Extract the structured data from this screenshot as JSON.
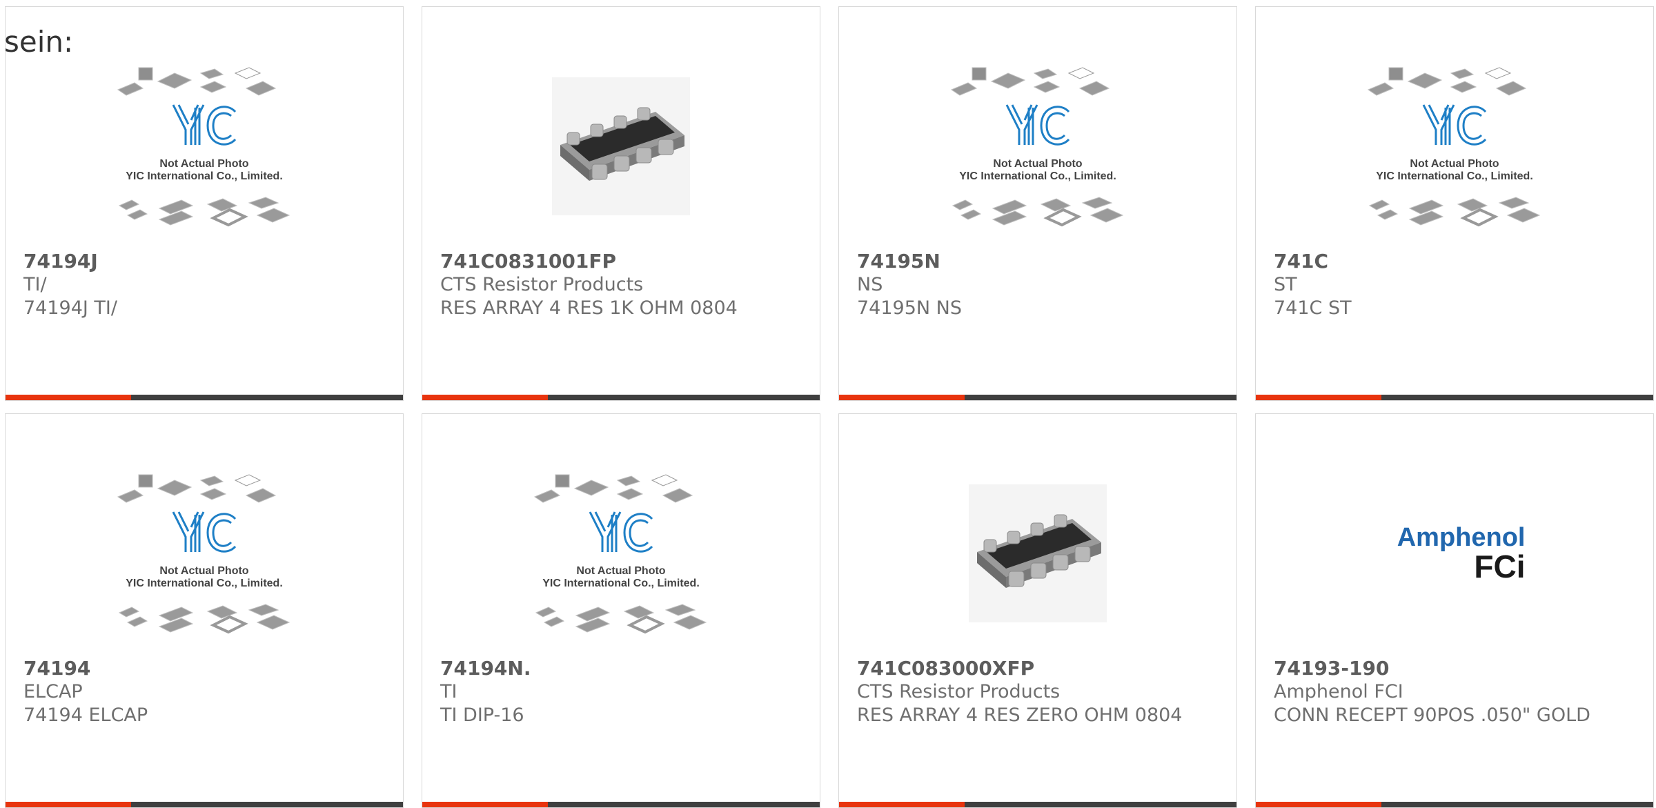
{
  "heading": "sein:",
  "colors": {
    "accent": "#e8340e",
    "bar_dark": "#3f3f3f",
    "yic_blue": "#1e7fc6",
    "amphenol_blue": "#2167ae"
  },
  "placeholder": {
    "line1": "Not Actual Photo",
    "line2": "YIC International Co., Limited."
  },
  "amphenol_logo": {
    "line1": "Amphenol",
    "line2": "FCi"
  },
  "products": [
    {
      "pn": "74194J",
      "mfr": "TI/",
      "desc": "74194J TI/",
      "image": "yic-placeholder"
    },
    {
      "pn": "741C0831001FP",
      "mfr": "CTS Resistor Products",
      "desc": "RES ARRAY 4 RES 1K OHM 0804",
      "image": "resistor-array"
    },
    {
      "pn": "74195N",
      "mfr": "NS",
      "desc": "74195N NS",
      "image": "yic-placeholder"
    },
    {
      "pn": "741C",
      "mfr": "ST",
      "desc": "741C ST",
      "image": "yic-placeholder"
    },
    {
      "pn": "74194",
      "mfr": "ELCAP",
      "desc": "74194 ELCAP",
      "image": "yic-placeholder"
    },
    {
      "pn": "74194N.",
      "mfr": "TI",
      "desc": "TI DIP-16",
      "image": "yic-placeholder"
    },
    {
      "pn": "741C083000XFP",
      "mfr": "CTS Resistor Products",
      "desc": "RES ARRAY 4 RES ZERO OHM 0804",
      "image": "resistor-array"
    },
    {
      "pn": "74193-190",
      "mfr": "Amphenol FCI",
      "desc": "CONN RECEPT 90POS .050\" GOLD",
      "image": "amphenol-logo"
    }
  ]
}
